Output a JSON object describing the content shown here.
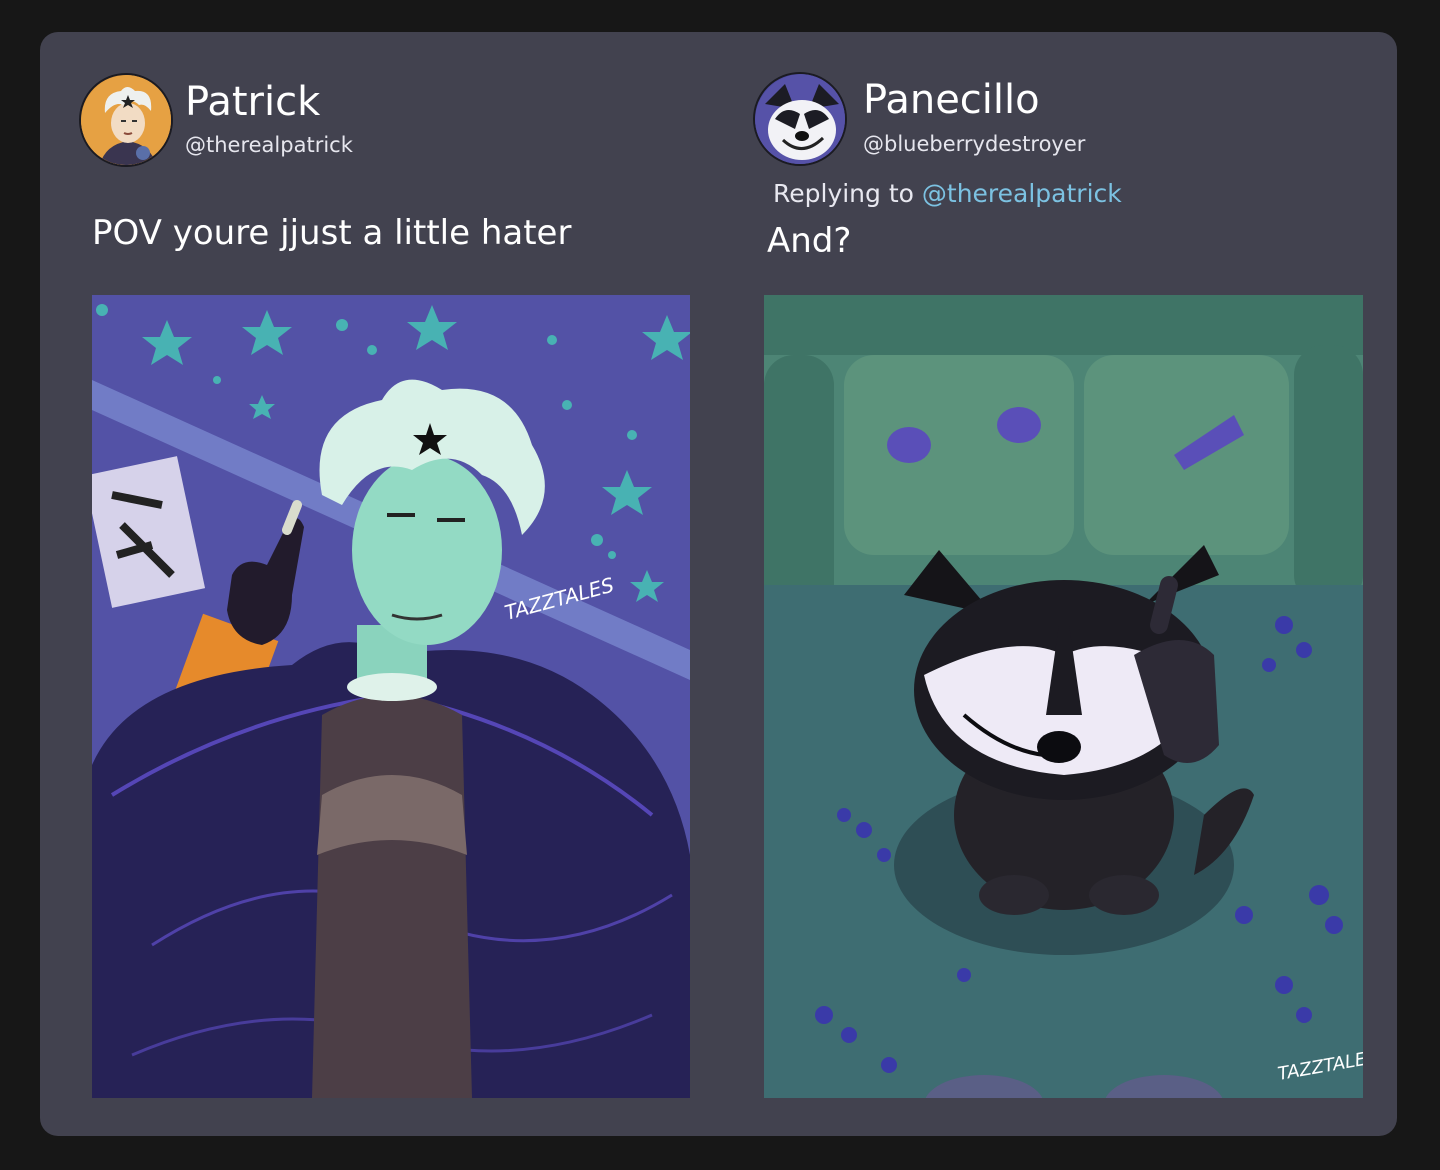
{
  "posts": [
    {
      "user": {
        "name": "Patrick",
        "handle": "@therealpatrick"
      },
      "text": "POV youre jjust a little hater",
      "media": {
        "description": "Illustration of a white-haired young man in a dark purple jacket raising his middle finger in front of a star-covered wall",
        "watermark": "TAZZTALES"
      }
    },
    {
      "user": {
        "name": "Panecillo",
        "handle": "@blueberrydestroyer"
      },
      "reply": {
        "prefix": "Replying to ",
        "mention": "@therealpatrick"
      },
      "text": "And?",
      "media": {
        "description": "Illustration of a black and white dog sitting on a teal floor covered in blueberries in front of a green couch, giving the middle finger",
        "watermark": "TAZZTALES"
      }
    }
  ],
  "colors": {
    "card": "#42424f",
    "background": "#171717",
    "mention": "#7cc2e2",
    "text": "#ffffff"
  }
}
